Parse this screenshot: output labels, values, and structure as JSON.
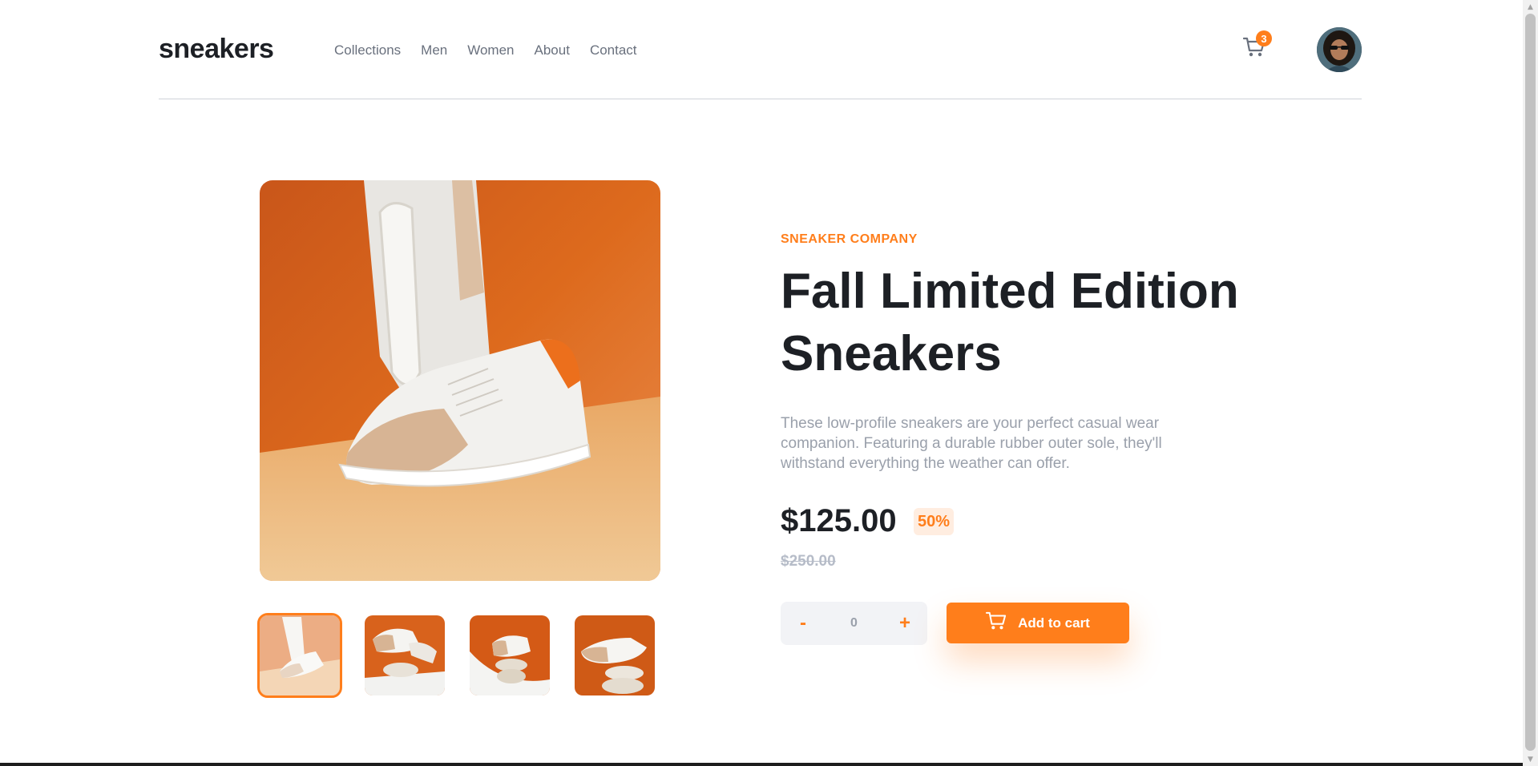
{
  "header": {
    "logo": "sneakers",
    "nav": [
      "Collections",
      "Men",
      "Women",
      "About",
      "Contact"
    ],
    "cart_count": "3"
  },
  "product": {
    "company": "SNEAKER COMPANY",
    "title": "Fall Limited Edition Sneakers",
    "description": "These low-profile sneakers are your perfect casual wear companion. Featuring a durable rubber outer sole, they'll withstand everything the weather can offer.",
    "price": "$125.00",
    "discount": "50%",
    "old_price": "$250.00",
    "quantity": "0",
    "minus_label": "-",
    "plus_label": "+",
    "add_to_cart_label": "Add to cart"
  },
  "gallery": {
    "active_thumbnail": 1,
    "thumbnails": 4
  },
  "colors": {
    "accent": "#ff7e1b",
    "accent_pale": "#ffede0",
    "dark": "#1d2025",
    "muted": "#69707d"
  }
}
